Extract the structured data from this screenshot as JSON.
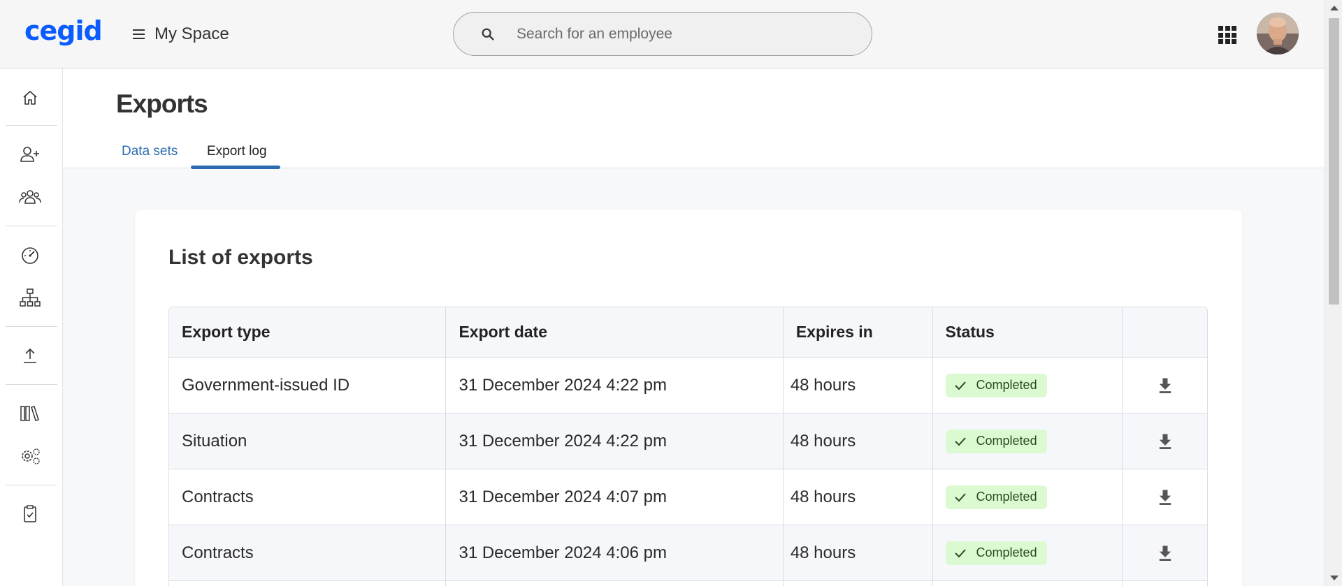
{
  "brand": {
    "logo_text": "cegid",
    "accent": "#0a5cff",
    "link_color": "#2b6cb0"
  },
  "topbar": {
    "menu_label": "My Space",
    "search_placeholder": "Search for an employee",
    "apps_icon": "grid-apps-icon",
    "avatar": "user-avatar"
  },
  "sidenav": {
    "items": [
      {
        "name": "home",
        "icon": "home-icon"
      },
      {
        "name": "add-employee",
        "icon": "person-add-icon"
      },
      {
        "name": "teams",
        "icon": "group-icon"
      },
      {
        "name": "dashboard",
        "icon": "speedometer-icon"
      },
      {
        "name": "org-chart",
        "icon": "org-chart-icon"
      },
      {
        "name": "upload",
        "icon": "upload-icon"
      },
      {
        "name": "library",
        "icon": "library-icon"
      },
      {
        "name": "settings",
        "icon": "gears-icon"
      },
      {
        "name": "tasks",
        "icon": "clipboard-check-icon"
      }
    ]
  },
  "page": {
    "title": "Exports",
    "tabs": [
      {
        "label": "Data sets",
        "active": false
      },
      {
        "label": "Export log",
        "active": true
      }
    ]
  },
  "card": {
    "title": "List of exports",
    "columns": [
      "Export type",
      "Export date",
      "Expires in",
      "Status",
      ""
    ],
    "rows": [
      {
        "type": "Government-issued ID",
        "date": "31 December 2024 4:22 pm",
        "expires": "48 hours",
        "status": "Completed"
      },
      {
        "type": "Situation",
        "date": "31 December 2024 4:22 pm",
        "expires": "48 hours",
        "status": "Completed"
      },
      {
        "type": "Contracts",
        "date": "31 December 2024 4:07 pm",
        "expires": "48 hours",
        "status": "Completed"
      },
      {
        "type": "Contracts",
        "date": "31 December 2024 4:06 pm",
        "expires": "48 hours",
        "status": "Completed"
      }
    ],
    "status_color": "#dcfad2"
  }
}
